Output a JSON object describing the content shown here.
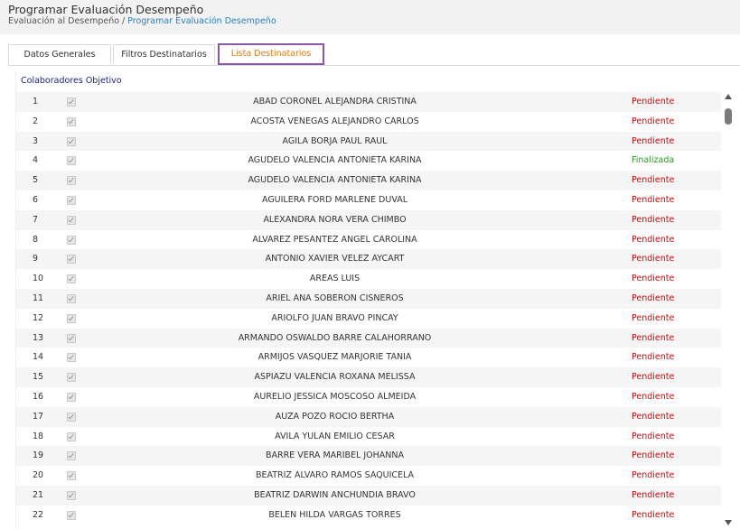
{
  "header": {
    "title": "Programar Evaluación Desempeño",
    "breadcrumb": {
      "parent": "Evaluación al Desempeño",
      "separator": "/",
      "current": "Programar Evaluación Desempeño"
    }
  },
  "tabs": [
    {
      "label": "Datos Generales"
    },
    {
      "label": "Filtros Destinatarios"
    },
    {
      "label": "Lista Destinatarios",
      "active": true
    }
  ],
  "section": {
    "title": "Colaboradores Objetivo"
  },
  "colors": {
    "pending": "#e00000",
    "finalized": "#1aa01a",
    "active_tab_text": "#e07b1a",
    "active_tab_border": "#8a5aa8",
    "link": "#2a7fc1"
  },
  "rows": [
    {
      "num": "1",
      "name": "ABAD CORONEL ALEJANDRA CRISTINA",
      "status": "Pendiente",
      "checked": true
    },
    {
      "num": "2",
      "name": "ACOSTA VENEGAS ALEJANDRO CARLOS",
      "status": "Pendiente",
      "checked": true
    },
    {
      "num": "3",
      "name": "AGILA BORJA PAUL RAUL",
      "status": "Pendiente",
      "checked": true
    },
    {
      "num": "4",
      "name": "AGUDELO VALENCIA ANTONIETA KARINA",
      "status": "Finalizada",
      "checked": true
    },
    {
      "num": "5",
      "name": "AGUDELO VALENCIA ANTONIETA KARINA",
      "status": "Pendiente",
      "checked": true
    },
    {
      "num": "6",
      "name": "AGUILERA FORD MARLENE DUVAL",
      "status": "Pendiente",
      "checked": true
    },
    {
      "num": "7",
      "name": "ALEXANDRA  NORA VERA CHIMBO",
      "status": "Pendiente",
      "checked": true
    },
    {
      "num": "8",
      "name": "ALVAREZ PESANTEZ ANGEL CAROLINA",
      "status": "Pendiente",
      "checked": true
    },
    {
      "num": "9",
      "name": "ANTONIO XAVIER VELEZ AYCART",
      "status": "Pendiente",
      "checked": true
    },
    {
      "num": "10",
      "name": "AREAS LUIS",
      "status": "Pendiente",
      "checked": true
    },
    {
      "num": "11",
      "name": "ARIEL ANA SOBERON CISNEROS",
      "status": "Pendiente",
      "checked": true
    },
    {
      "num": "12",
      "name": "ARIOLFO JUAN BRAVO PINCAY",
      "status": "Pendiente",
      "checked": true
    },
    {
      "num": "13",
      "name": "ARMANDO OSWALDO BARRE CALAHORRANO",
      "status": "Pendiente",
      "checked": true
    },
    {
      "num": "14",
      "name": "ARMIJOS VASQUEZ MARJORIE TANIA",
      "status": "Pendiente",
      "checked": true
    },
    {
      "num": "15",
      "name": "ASPIAZU VALENCIA ROXANA MELISSA",
      "status": "Pendiente",
      "checked": true
    },
    {
      "num": "16",
      "name": "AURELIO JESSICA MOSCOSO ALMEIDA",
      "status": "Pendiente",
      "checked": true
    },
    {
      "num": "17",
      "name": "AUZA POZO ROCIO BERTHA",
      "status": "Pendiente",
      "checked": true
    },
    {
      "num": "18",
      "name": "AVILA YULAN EMILIO CESAR",
      "status": "Pendiente",
      "checked": true
    },
    {
      "num": "19",
      "name": "BARRE VERA MARIBEL JOHANNA",
      "status": "Pendiente",
      "checked": true
    },
    {
      "num": "20",
      "name": "BEATRIZ ALVARO RAMOS SAQUICELA",
      "status": "Pendiente",
      "checked": true
    },
    {
      "num": "21",
      "name": "BEATRIZ  DARWIN ANCHUNDIA BRAVO",
      "status": "Pendiente",
      "checked": true
    },
    {
      "num": "22",
      "name": "BELEN HILDA VARGAS TORRES",
      "status": "Pendiente",
      "checked": true
    }
  ]
}
